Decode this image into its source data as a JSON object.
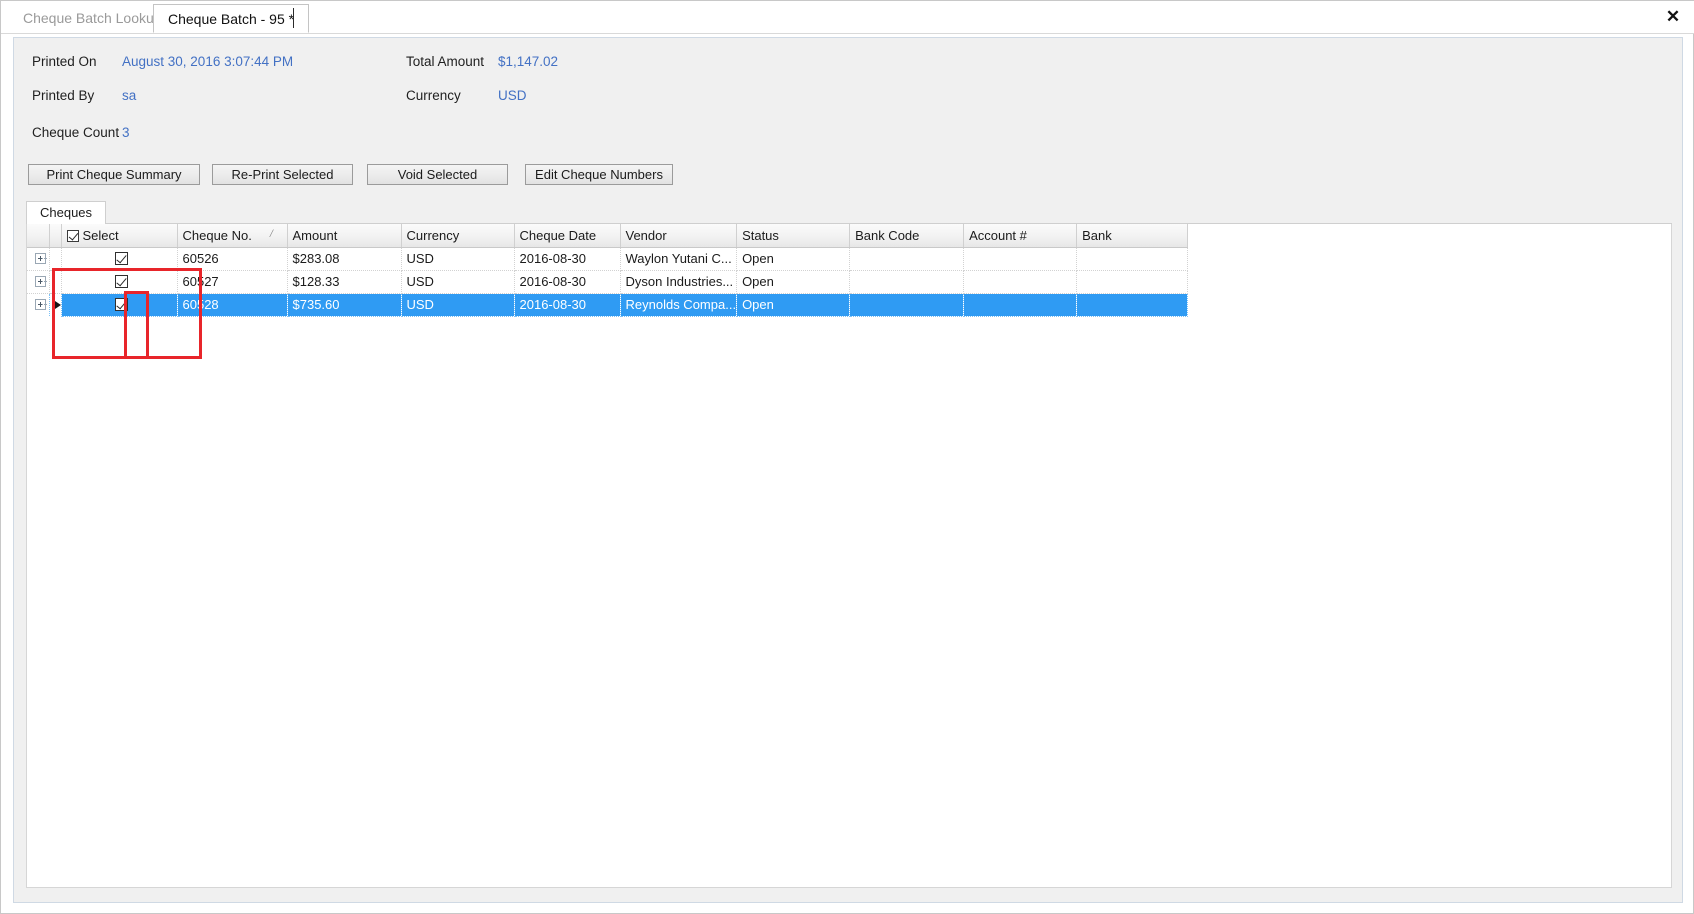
{
  "window": {
    "close_label": "✕"
  },
  "tabs": [
    {
      "label": "Cheque Batch Lookup",
      "active": false
    },
    {
      "label": "Cheque Batch - 95 *",
      "active": true
    }
  ],
  "summary": {
    "printed_on_label": "Printed On",
    "printed_on_value": "August 30, 2016 3:07:44 PM",
    "printed_by_label": "Printed By",
    "printed_by_value": "sa",
    "cheque_count_label": "Cheque Count",
    "cheque_count_value": "3",
    "total_amount_label": "Total Amount",
    "total_amount_value": "$1,147.02",
    "currency_label": "Currency",
    "currency_value": "USD",
    "value_color": "#4371c4"
  },
  "toolbar": {
    "print_summary_label": "Print Cheque Summary",
    "reprint_selected_label": "Re-Print Selected",
    "void_selected_label": "Void Selected",
    "edit_cheque_numbers_label": "Edit Cheque Numbers"
  },
  "inner_tab": {
    "label": "Cheques"
  },
  "grid": {
    "headers": {
      "select": "Select",
      "cheque_no": "Cheque No.",
      "amount": "Amount",
      "currency": "Currency",
      "cheque_date": "Cheque Date",
      "vendor": "Vendor",
      "status": "Status",
      "bank_code": "Bank Code",
      "account_no": "Account #",
      "bank": "Bank"
    },
    "sort_indicator": "⁄",
    "select_all_checked": true,
    "rows": [
      {
        "selected_checkbox": true,
        "cheque_no": "60526",
        "amount": "$283.08",
        "currency": "USD",
        "cheque_date": "2016-08-30",
        "vendor": "Waylon Yutani C...",
        "status": "Open",
        "bank_code": "",
        "account_no": "",
        "bank": "",
        "highlighted": false,
        "is_current": false
      },
      {
        "selected_checkbox": true,
        "cheque_no": "60527",
        "amount": "$128.33",
        "currency": "USD",
        "cheque_date": "2016-08-30",
        "vendor": "Dyson Industries...",
        "status": "Open",
        "bank_code": "",
        "account_no": "",
        "bank": "",
        "highlighted": false,
        "is_current": false
      },
      {
        "selected_checkbox": true,
        "cheque_no": "60528",
        "amount": "$735.60",
        "currency": "USD",
        "cheque_date": "2016-08-30",
        "vendor": "Reynolds Compa...",
        "status": "Open",
        "bank_code": "",
        "account_no": "",
        "bank": "",
        "highlighted": true,
        "is_current": true
      }
    ],
    "selection_color": "#2f9bf3"
  },
  "annotations": {
    "highlight_color": "#e8252a",
    "boxes": [
      {
        "name": "select-column-highlight"
      },
      {
        "name": "row-checkboxes-highlight"
      }
    ]
  }
}
